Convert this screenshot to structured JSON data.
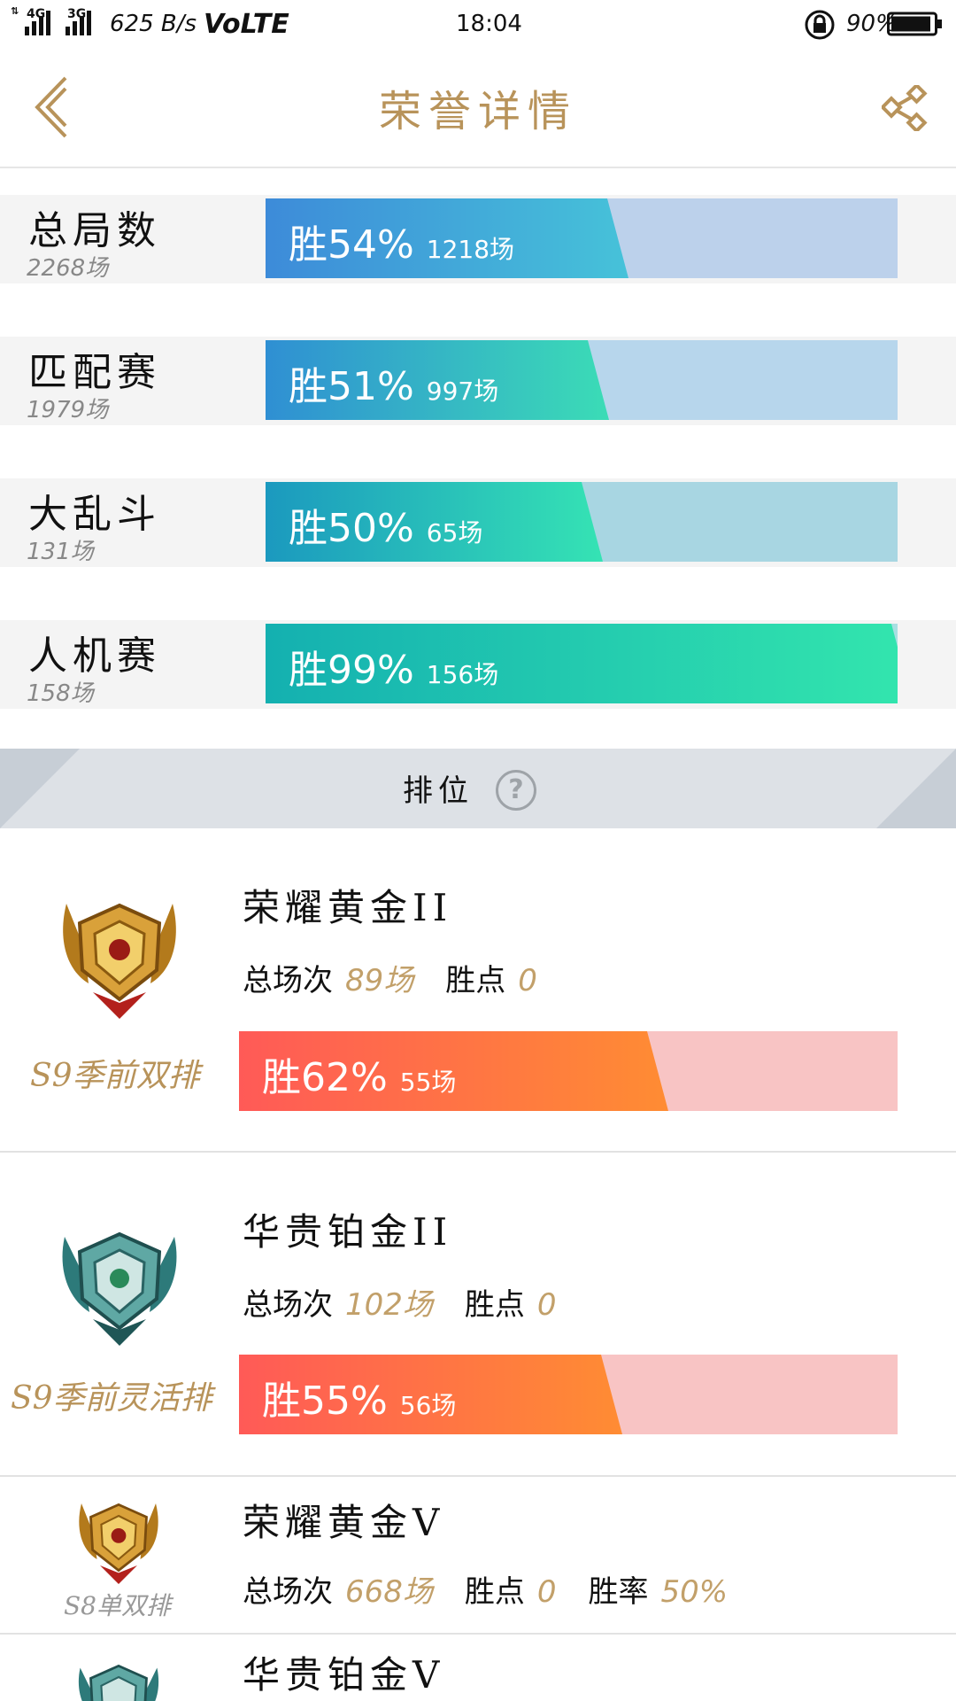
{
  "status_bar": {
    "net_a": "4G",
    "net_b": "3G",
    "speed": "625 B/s",
    "volte": "VoLTE",
    "time": "18:04",
    "battery": "90%"
  },
  "header": {
    "title": "荣誉详情"
  },
  "modes": [
    {
      "name": "总局数",
      "count": "2268场",
      "win_label": "胜54%",
      "games": "1218场",
      "win_fraction": 0.54
    },
    {
      "name": "匹配赛",
      "count": "1979场",
      "win_label": "胜51%",
      "games": "997场",
      "win_fraction": 0.51
    },
    {
      "name": "大乱斗",
      "count": "131场",
      "win_label": "胜50%",
      "games": "65场",
      "win_fraction": 0.5
    },
    {
      "name": "人机赛",
      "count": "158场",
      "win_label": "胜99%",
      "games": "156场",
      "win_fraction": 0.99
    }
  ],
  "rank_section": {
    "title": "排位",
    "help": "?"
  },
  "ranks": [
    {
      "name": "荣耀黄金II",
      "season": "S9季前双排",
      "total_label": "总场次",
      "total": "89场",
      "points_label": "胜点",
      "points": "0",
      "win_label": "胜62%",
      "games": "55场",
      "win_fraction": 0.62,
      "badge": "gold-badge-icon"
    },
    {
      "name": "华贵铂金II",
      "season": "S9季前灵活排",
      "total_label": "总场次",
      "total": "102场",
      "points_label": "胜点",
      "points": "0",
      "win_label": "胜55%",
      "games": "56场",
      "win_fraction": 0.55,
      "badge": "platinum-badge-icon"
    },
    {
      "name": "荣耀黄金V",
      "season": "S8单双排",
      "total_label": "总场次",
      "total": "668场",
      "points_label": "胜点",
      "points": "0",
      "rate_label": "胜率",
      "rate": "50%",
      "badge": "gold-badge-icon"
    },
    {
      "name": "华贵铂金V",
      "badge": "platinum-badge-icon"
    }
  ],
  "colors": {
    "accent_gold": "#b8935a",
    "mode_bar_1": [
      "#3d8bd9",
      "#46c2d9",
      "#bcd1eb"
    ],
    "mode_bar_2": [
      "#2f8fd3",
      "#3bdcb6",
      "#b7d6ec"
    ],
    "mode_bar_3": [
      "#1b99bf",
      "#35e3b4",
      "#a8d6e2"
    ],
    "mode_bar_4": [
      "#14b0b0",
      "#33e6ae",
      "#a8dfe2"
    ],
    "rank_bar": [
      "#ff5a57",
      "#ff8c33",
      "#f8c4c4"
    ]
  }
}
